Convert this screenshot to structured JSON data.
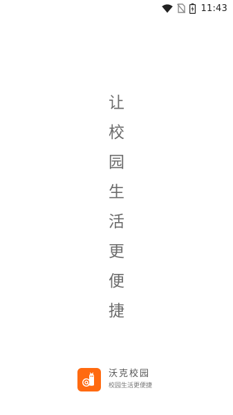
{
  "status_bar": {
    "time": "11:43",
    "icons": [
      "wifi-icon",
      "no-sim-icon",
      "battery-charging-icon"
    ]
  },
  "splash": {
    "slogan_chars": [
      "让",
      "校",
      "园",
      "生",
      "活",
      "更",
      "便",
      "捷"
    ]
  },
  "brand": {
    "logo_icon": "at-sign-mascot-logo",
    "accent_color": "#ff6a10",
    "name": "沃克校园",
    "tagline": "校园生活更便捷"
  }
}
